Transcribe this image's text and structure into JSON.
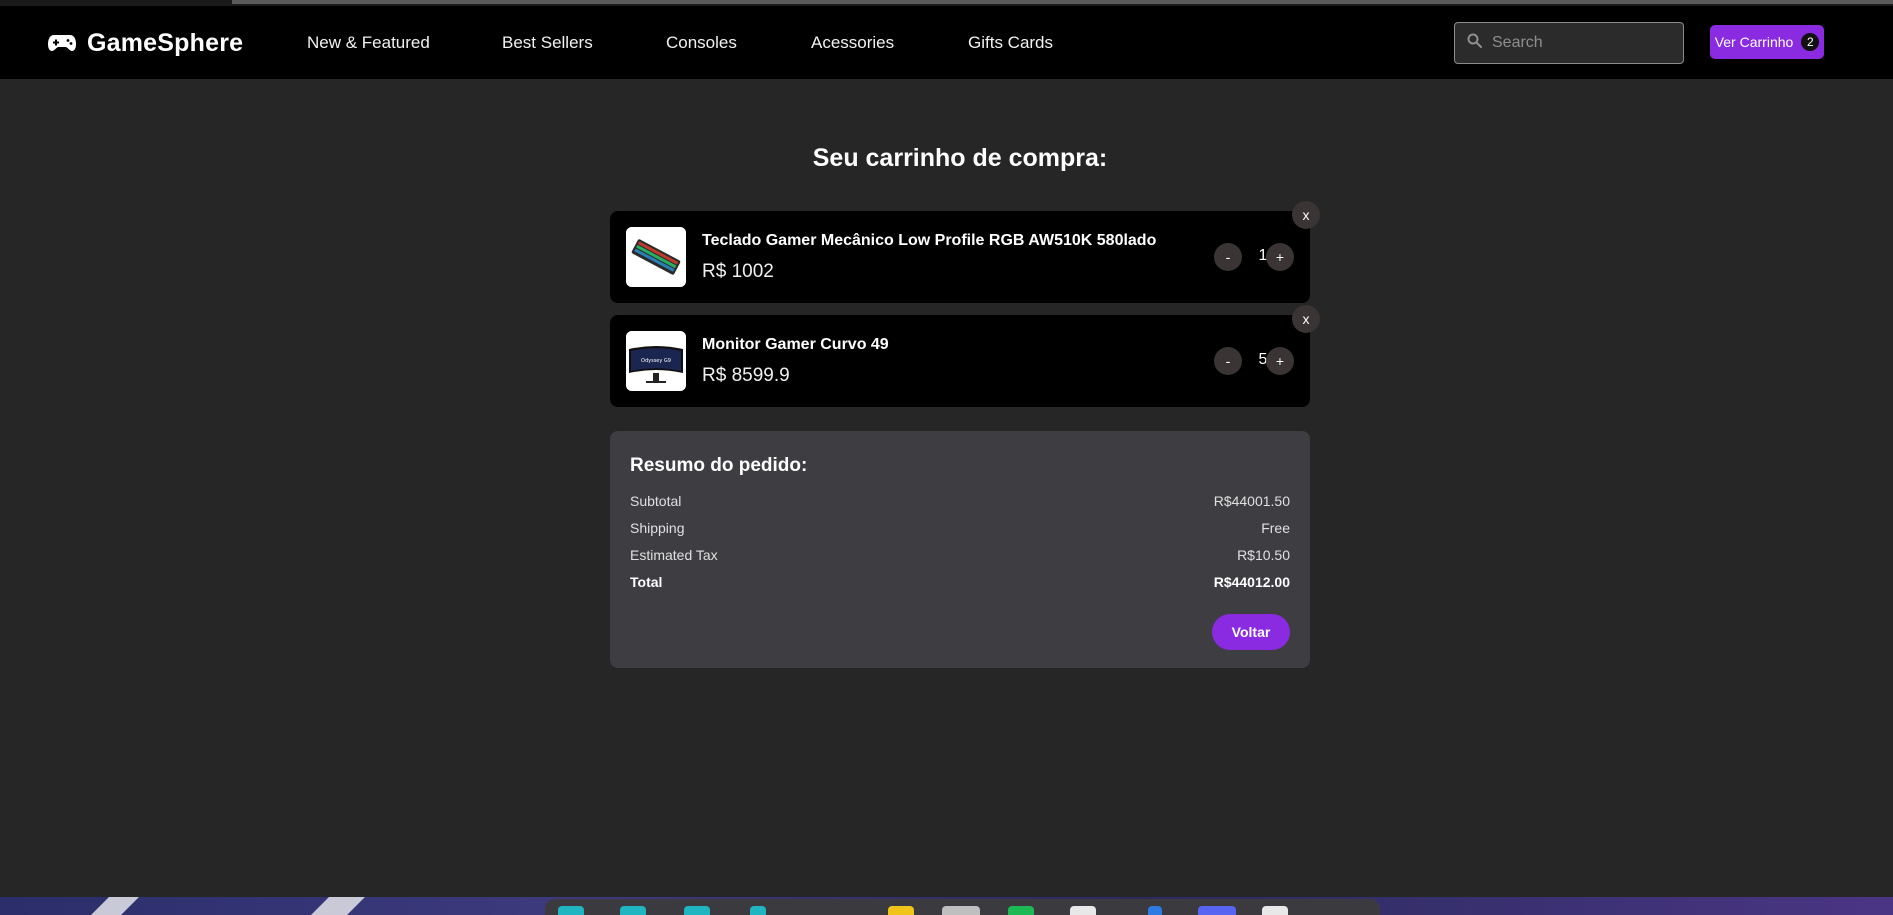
{
  "brand": {
    "name": "GameSphere",
    "icon": "gamepad-icon"
  },
  "nav": {
    "links": [
      "New & Featured",
      "Best Sellers",
      "Consoles",
      "Acessories",
      "Gifts Cards"
    ]
  },
  "search": {
    "placeholder": "Search",
    "value": "",
    "icon": "search-icon"
  },
  "cart_button": {
    "label": "Ver Carrinho",
    "count": "2"
  },
  "page": {
    "title": "Seu carrinho de compra:"
  },
  "cart": {
    "items": [
      {
        "name": "Teclado Gamer Mecânico Low Profile RGB AW510K 580lado",
        "price": "R$ 1002",
        "quantity": "1",
        "decrement_label": "-",
        "increment_label": "+",
        "remove_label": "x",
        "thumbnail": "keyboard-image"
      },
      {
        "name": "Monitor Gamer Curvo 49",
        "price": "R$ 8599.9",
        "quantity": "5",
        "decrement_label": "-",
        "increment_label": "+",
        "remove_label": "x",
        "thumbnail": "monitor-image"
      }
    ]
  },
  "summary": {
    "title": "Resumo do pedido:",
    "rows": [
      {
        "label": "Subtotal",
        "value": "R$44001.50"
      },
      {
        "label": "Shipping",
        "value": "Free"
      },
      {
        "label": "Estimated Tax",
        "value": "R$10.50"
      },
      {
        "label": "Total",
        "value": "R$44012.00"
      }
    ],
    "back_label": "Voltar"
  },
  "colors": {
    "accent": "#8a2be2",
    "background": "#262626",
    "navbar": "#000000",
    "card": "#000000",
    "summary": "#3d3d42"
  }
}
